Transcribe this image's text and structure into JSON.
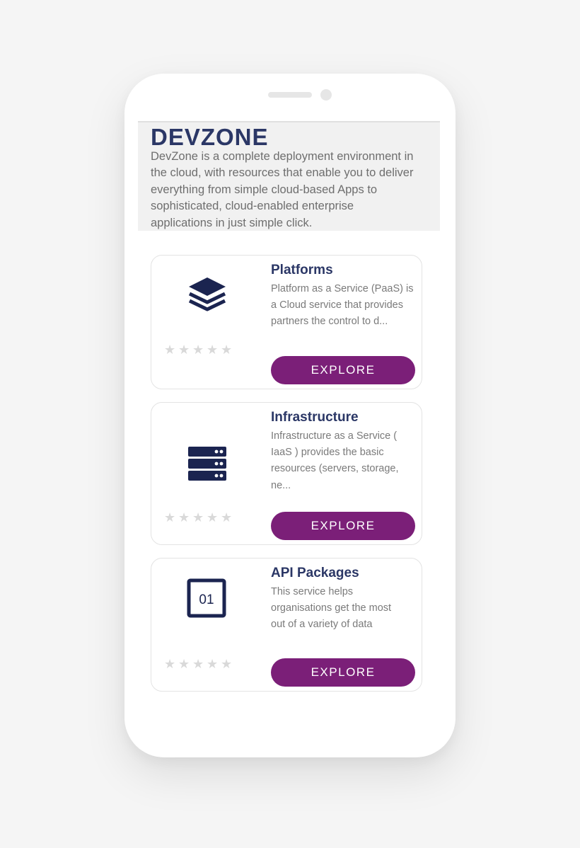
{
  "app": {
    "title": "DEVZONE",
    "description": "DevZone is a complete deployment environment in\nthe cloud, with resources that enable you to deliver\neverything from simple cloud-based Apps to\nsophisticated, cloud-enabled enterprise\napplications in just simple click."
  },
  "colors": {
    "accent": "#7b1f78",
    "title": "#2b3766",
    "icon": "#1b2450",
    "star": "#d9d9d9"
  },
  "cards": [
    {
      "title": "Platforms",
      "icon": "layers-icon",
      "description": "Platform as a Service (PaaS) is\na Cloud service that provides\npartners the control to d...",
      "rating": 0,
      "button_label": "EXPLORE"
    },
    {
      "title": "Infrastructure",
      "icon": "server-icon",
      "description": "Infrastructure as a Service (\nIaaS ) provides the basic\nresources (servers, storage,\nne...",
      "rating": 0,
      "button_label": "EXPLORE"
    },
    {
      "title": "API Packages",
      "icon": "api-package-icon",
      "icon_text": "01",
      "description": "This service helps\norganisations get the most\nout of a variety of data",
      "rating": 0,
      "button_label": "EXPLORE"
    }
  ]
}
